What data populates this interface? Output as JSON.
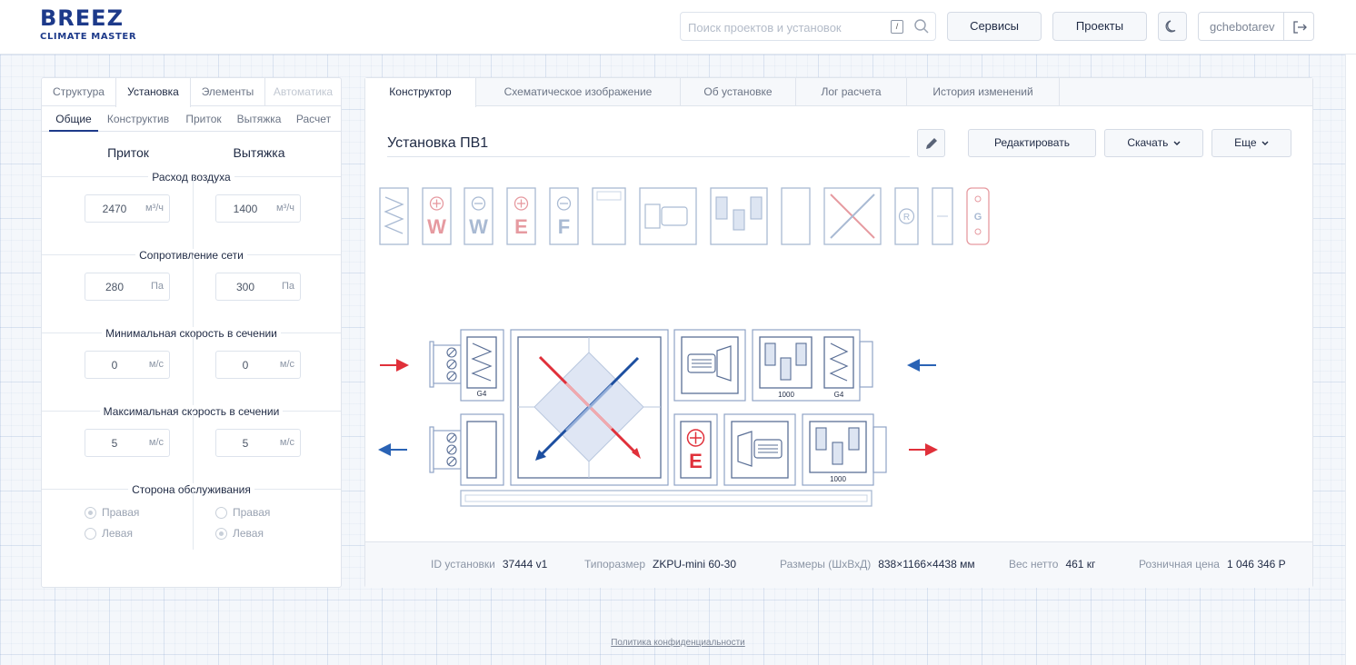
{
  "brand": {
    "line1": "BREEZ",
    "line2": "CLIMATE MASTER",
    "color": "#1d3a8a"
  },
  "search": {
    "placeholder": "Поиск проектов и установок",
    "shortcut": "/",
    "icon": "search-icon"
  },
  "header": {
    "services_label": "Сервисы",
    "projects_label": "Проекты",
    "theme_icon": "moon-icon",
    "username": "gchebotarev",
    "logout_icon": "logout-icon"
  },
  "left": {
    "tabs": [
      "Структура",
      "Установка",
      "Элементы",
      "Автоматика"
    ],
    "active_tab": "Установка",
    "subtabs": [
      "Общие",
      "Конструктив",
      "Приток",
      "Вытяжка",
      "Расчет"
    ],
    "active_subtab": "Общие",
    "col_supply": "Приток",
    "col_exhaust": "Вытяжка",
    "sections": [
      {
        "title": "Расход воздуха",
        "supply": "2470",
        "exhaust": "1400",
        "unit": "м³/ч"
      },
      {
        "title": "Сопротивление сети",
        "supply": "280",
        "exhaust": "300",
        "unit": "Па"
      },
      {
        "title": "Минимальная скорость в сечении",
        "supply": "0",
        "exhaust": "0",
        "unit": "м/с"
      },
      {
        "title": "Максимальная скорость в сечении",
        "supply": "5",
        "exhaust": "5",
        "unit": "м/с"
      }
    ],
    "service_side": {
      "title": "Сторона обслуживания",
      "right_label": "Правая",
      "left_label": "Левая",
      "supply_selected": "Правая",
      "exhaust_selected": "Левая"
    }
  },
  "right": {
    "tabs": [
      "Конструктор",
      "Схематическое изображение",
      "Об установке",
      "Лог расчета",
      "История изменений"
    ],
    "active_tab": "Конструктор",
    "unit_name": "Установка ПВ1",
    "edit_icon": "pencil-icon",
    "edit_label": "Редактировать",
    "download_label": "Скачать",
    "more_label": "Еще",
    "palette_letters": [
      "W",
      "W",
      "E",
      "F",
      "R",
      "G"
    ],
    "schema_labels": {
      "filter1": "G4",
      "fan_size1": "1000",
      "filter2": "G4",
      "heater": "E",
      "fan_size2": "1000"
    },
    "meta": {
      "id_label": "ID установки",
      "id_value": "37444 v1",
      "size_label": "Типоразмер",
      "size_value": "ZKPU-mini 60-30",
      "dims_label": "Размеры (ШхВхД)",
      "dims_value": "838×1166×4438 мм",
      "weight_label": "Вес нетто",
      "weight_value": "461 кг",
      "price_label": "Розничная цена",
      "price_value": "1 046 346 Р"
    }
  },
  "footer": {
    "privacy_label": "Политика конфиденциальности"
  },
  "colors": {
    "accent_red": "#e0303a",
    "accent_blue": "#2a63b5",
    "line": "#9fb2d0"
  }
}
